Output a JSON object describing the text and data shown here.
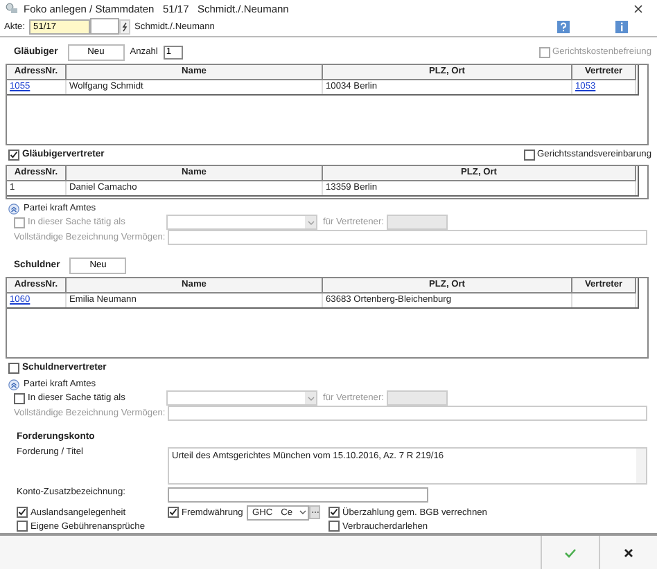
{
  "window": {
    "title": "Foko anlegen / Stammdaten   51/17   Schmidt./.Neumann"
  },
  "akte": {
    "label": "Akte:",
    "value": "51/17",
    "name": "Schmidt./.Neumann"
  },
  "glaeubiger": {
    "title": "Gläubiger",
    "new_button": "Neu",
    "count_label": "Anzahl",
    "count": "1",
    "exemption": {
      "label": "Gerichtskostenbefreiung",
      "checked": false,
      "disabled": true
    },
    "table": {
      "columns": [
        "AdressNr.",
        "Name",
        "PLZ, Ort",
        "Vertreter"
      ],
      "rows": [
        [
          {
            "text": "1055",
            "link": true
          },
          {
            "text": "Wolfgang Schmidt",
            "link": false
          },
          {
            "text": "10034 Berlin",
            "link": false
          },
          {
            "text": "1053",
            "link": true
          }
        ]
      ]
    }
  },
  "glaeubigervertreter": {
    "label": "Gläubigervertreter",
    "checked": true,
    "agreement": {
      "label": "Gerichtsstandsvereinbarung",
      "checked": false
    },
    "table": {
      "columns": [
        "AdressNr.",
        "Name",
        "PLZ, Ort"
      ],
      "rows": [
        [
          {
            "text": "1",
            "link": false
          },
          {
            "text": "Daniel Camacho",
            "link": false
          },
          {
            "text": "13359 Berlin",
            "link": false
          }
        ]
      ]
    },
    "party": {
      "label": "Partei kraft Amtes",
      "active_as": {
        "label": "In dieser Sache tätig als",
        "checked": false,
        "disabled": true
      },
      "for_label": "für Vertretener:",
      "full_label": "Vollständige Bezeichnung Vermögen:"
    }
  },
  "schuldner": {
    "title": "Schuldner",
    "new_button": "Neu",
    "table": {
      "columns": [
        "AdressNr.",
        "Name",
        "PLZ, Ort",
        "Vertreter"
      ],
      "rows": [
        [
          {
            "text": "1060",
            "link": true
          },
          {
            "text": "Emilia Neumann",
            "link": false
          },
          {
            "text": "63683 Ortenberg-Bleichenburg",
            "link": false
          }
        ]
      ]
    }
  },
  "schuldnervertreter": {
    "label": "Schuldnervertreter",
    "checked": false,
    "party": {
      "label": "Partei kraft Amtes",
      "active_as": {
        "label": "In dieser Sache tätig als",
        "checked": false,
        "disabled": false
      },
      "for_label": "für Vertretener:",
      "full_label": "Vollständige Bezeichnung Vermögen:"
    }
  },
  "forderungskonto": {
    "title": "Forderungskonto",
    "claim_label": "Forderung / Titel",
    "claim": "Urteil des Amtsgerichtes München vom 15.10.2016, Az. 7 R 219/16",
    "extra_label": "Konto-Zusatzbezeichnung:",
    "foreign": {
      "label": "Auslandsangelegenheit",
      "checked": true
    },
    "own_fees": {
      "label": "Eigene Gebührenansprüche",
      "checked": false
    },
    "currency": {
      "label": "Fremdwährung",
      "checked": true,
      "code": "GHC",
      "name": "Ce"
    },
    "overpay": {
      "label": "Überzahlung gem. BGB verrechnen",
      "checked": true
    },
    "consumer": {
      "label": "Verbraucherdarlehen",
      "checked": false
    }
  }
}
